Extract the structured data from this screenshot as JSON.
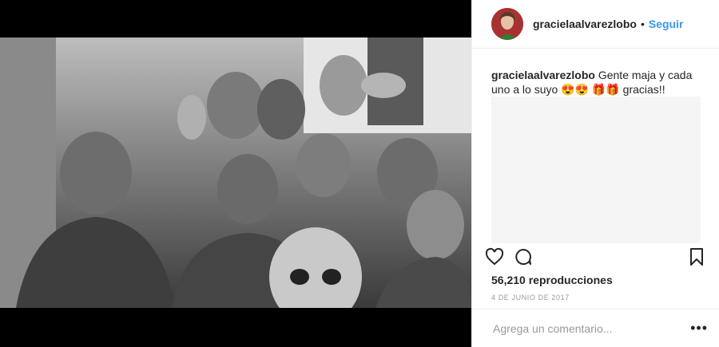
{
  "post": {
    "username": "gracielaalvarezlobo",
    "separator": "•",
    "follow_label": "Seguir",
    "caption": {
      "username": "gracielaalvarezlobo",
      "text": "Gente maja y cada uno a lo suyo 😍😍 🎁🎁 gracias!!"
    },
    "views": "56,210 reproducciones",
    "date": "4 DE JUNIO DE 2017",
    "comment_placeholder": "Agrega un comentario...",
    "more_label": "•••"
  },
  "icons": {
    "like": "heart-icon",
    "comment": "comment-icon",
    "save": "bookmark-icon",
    "more": "ellipsis-icon"
  },
  "colors": {
    "accent": "#3897f0",
    "text": "#262626",
    "muted": "#999999"
  }
}
